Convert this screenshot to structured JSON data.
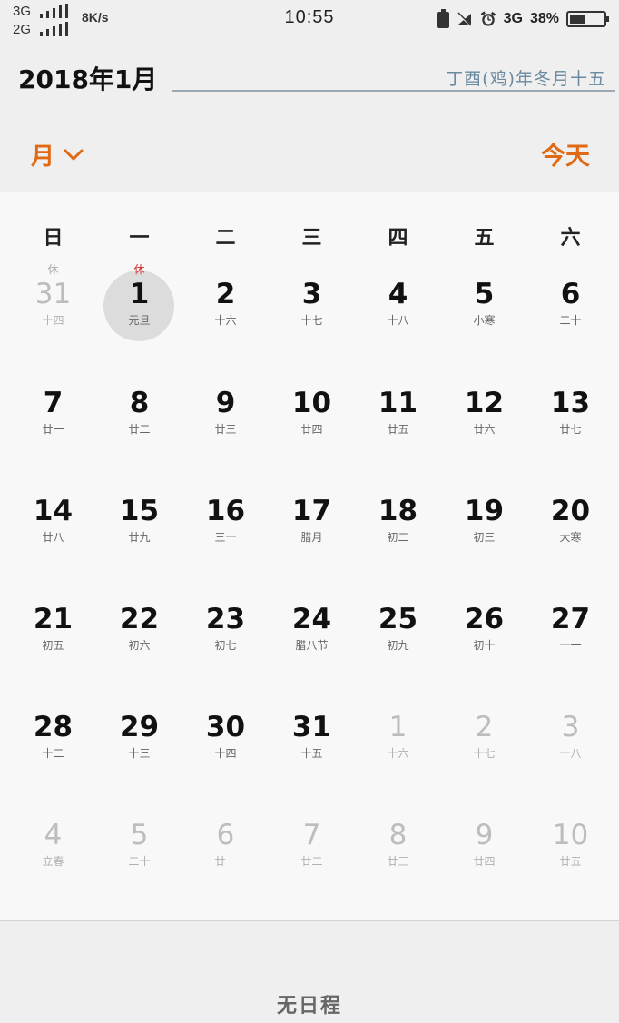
{
  "status": {
    "sig1_label": "3G",
    "sig2_label": "2G",
    "netspeed": "8K/s",
    "time": "10:55",
    "net_type": "3G",
    "battery": "38%",
    "battery_level": 0.38
  },
  "header": {
    "month_title": "2018年1月",
    "lunar_date": "丁酉(鸡)年冬月十五"
  },
  "toolbar": {
    "view_label": "月",
    "today_label": "今天"
  },
  "weekdays": [
    "日",
    "一",
    "二",
    "三",
    "四",
    "五",
    "六"
  ],
  "weeks": [
    [
      {
        "day": "31",
        "lunar": "十四",
        "tag": "休",
        "muted": true
      },
      {
        "day": "1",
        "lunar": "元旦",
        "tag": "休",
        "tag_red": true,
        "selected": true
      },
      {
        "day": "2",
        "lunar": "十六"
      },
      {
        "day": "3",
        "lunar": "十七"
      },
      {
        "day": "4",
        "lunar": "十八"
      },
      {
        "day": "5",
        "lunar": "小寒"
      },
      {
        "day": "6",
        "lunar": "二十"
      }
    ],
    [
      {
        "day": "7",
        "lunar": "廿一"
      },
      {
        "day": "8",
        "lunar": "廿二"
      },
      {
        "day": "9",
        "lunar": "廿三"
      },
      {
        "day": "10",
        "lunar": "廿四"
      },
      {
        "day": "11",
        "lunar": "廿五"
      },
      {
        "day": "12",
        "lunar": "廿六"
      },
      {
        "day": "13",
        "lunar": "廿七"
      }
    ],
    [
      {
        "day": "14",
        "lunar": "廿八"
      },
      {
        "day": "15",
        "lunar": "廿九"
      },
      {
        "day": "16",
        "lunar": "三十"
      },
      {
        "day": "17",
        "lunar": "腊月"
      },
      {
        "day": "18",
        "lunar": "初二"
      },
      {
        "day": "19",
        "lunar": "初三"
      },
      {
        "day": "20",
        "lunar": "大寒"
      }
    ],
    [
      {
        "day": "21",
        "lunar": "初五"
      },
      {
        "day": "22",
        "lunar": "初六"
      },
      {
        "day": "23",
        "lunar": "初七"
      },
      {
        "day": "24",
        "lunar": "腊八节"
      },
      {
        "day": "25",
        "lunar": "初九"
      },
      {
        "day": "26",
        "lunar": "初十"
      },
      {
        "day": "27",
        "lunar": "十一"
      }
    ],
    [
      {
        "day": "28",
        "lunar": "十二"
      },
      {
        "day": "29",
        "lunar": "十三"
      },
      {
        "day": "30",
        "lunar": "十四"
      },
      {
        "day": "31",
        "lunar": "十五"
      },
      {
        "day": "1",
        "lunar": "十六",
        "muted": true
      },
      {
        "day": "2",
        "lunar": "十七",
        "muted": true
      },
      {
        "day": "3",
        "lunar": "十八",
        "muted": true
      }
    ],
    [
      {
        "day": "4",
        "lunar": "立春",
        "muted": true
      },
      {
        "day": "5",
        "lunar": "二十",
        "muted": true
      },
      {
        "day": "6",
        "lunar": "廿一",
        "muted": true
      },
      {
        "day": "7",
        "lunar": "廿二",
        "muted": true
      },
      {
        "day": "8",
        "lunar": "廿三",
        "muted": true
      },
      {
        "day": "9",
        "lunar": "廿四",
        "muted": true
      },
      {
        "day": "10",
        "lunar": "廿五",
        "muted": true
      }
    ]
  ],
  "footer": {
    "empty_label": "无日程"
  },
  "colors": {
    "accent": "#e06a14",
    "lunar_header": "#6a8aa0",
    "holiday_red": "#d42a2a"
  }
}
